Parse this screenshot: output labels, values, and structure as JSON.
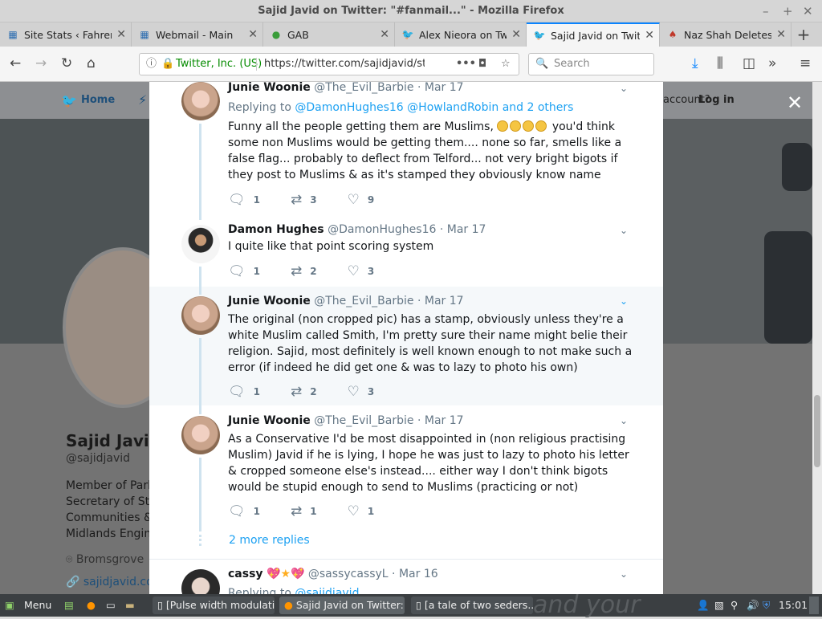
{
  "window": {
    "title": "Sajid Javid on Twitter: \"#fanmail...\" - Mozilla Firefox"
  },
  "tabs": [
    {
      "label": "Site Stats ‹ Fahrenh",
      "icon": "wordpress-grid-icon"
    },
    {
      "label": "Webmail - Main",
      "icon": "webmail-grid-icon"
    },
    {
      "label": "GAB",
      "icon": "gab-frog-icon"
    },
    {
      "label": "Alex Nieora on Twi",
      "icon": "twitter-bird-icon"
    },
    {
      "label": "Sajid Javid on Twitte",
      "icon": "twitter-bird-icon",
      "active": true
    },
    {
      "label": "Naz Shah Deletes",
      "icon": "news-icon"
    }
  ],
  "nav": {
    "identity": "Twitter, Inc. (US)",
    "url": "https://twitter.com/sajidjavid/status/",
    "search_placeholder": "Search"
  },
  "page_bg": {
    "nav_home": "Home",
    "account_prompt": "account?",
    "login": "Log in",
    "profile_name": "Sajid Javid",
    "profile_handle": "@sajidjavid",
    "bio_lines": [
      "Member of Parlia",
      "Secretary of Stat",
      "Communities & L",
      "Midlands Engine"
    ],
    "location": "Bromsgrove",
    "website": "sajidjavid.co"
  },
  "tweets": [
    {
      "name": "Junie Woonie",
      "handle": "@The_Evil_Barbie",
      "date": "Mar 17",
      "replying_prefix": "Replying to",
      "replying_to": [
        "@DamonHughes16",
        "@HowlandRobin"
      ],
      "replying_suffix": "and 2 others",
      "text_before_emoji": "Funny all the people getting them are Muslims,",
      "text_after_emoji": "you'd think some non Muslims would be getting them.... none so far, smells like a false flag... probably to deflect from Telford... not very bright bigots if they post to Muslims & as it's stamped they obviously know name",
      "replies": "1",
      "retweets": "3",
      "likes": "9"
    },
    {
      "name": "Damon Hughes",
      "handle": "@DamonHughes16",
      "date": "Mar 17",
      "text": "I quite like that point scoring system",
      "replies": "1",
      "retweets": "2",
      "likes": "3"
    },
    {
      "name": "Junie Woonie",
      "handle": "@The_Evil_Barbie",
      "date": "Mar 17",
      "text": "The original (non cropped pic) has a stamp, obviously unless they're a white Muslim called Smith, I'm pretty sure their name might belie their religion. Sajid, most definitely is well known enough to not make such a error (if indeed he did get one & was to lazy to photo his own)",
      "replies": "1",
      "retweets": "2",
      "likes": "3"
    },
    {
      "name": "Junie Woonie",
      "handle": "@The_Evil_Barbie",
      "date": "Mar 17",
      "text": "As a Conservative I'd be most disappointed in (non religious practising Muslim) Javid if he is lying, I hope he was just to lazy to photo his letter & cropped someone else's instead.... either way I don't think bigots would be stupid enough to send to Muslims (practicing or not)",
      "replies": "1",
      "retweets": "1",
      "likes": "1"
    }
  ],
  "more_replies": "2 more replies",
  "last_tweet": {
    "name": "cassy",
    "handle": "@sassycassyL",
    "date": "Mar 16",
    "replying_prefix": "Replying to",
    "replying_to": "@sajidjavid"
  },
  "taskbar": {
    "menu": "Menu",
    "windows": [
      "[Pulse width modulati...",
      "Sajid Javid on Twitter:...",
      "[a tale of two seders...."
    ],
    "clock": "15:01",
    "bg_text": "and your"
  }
}
